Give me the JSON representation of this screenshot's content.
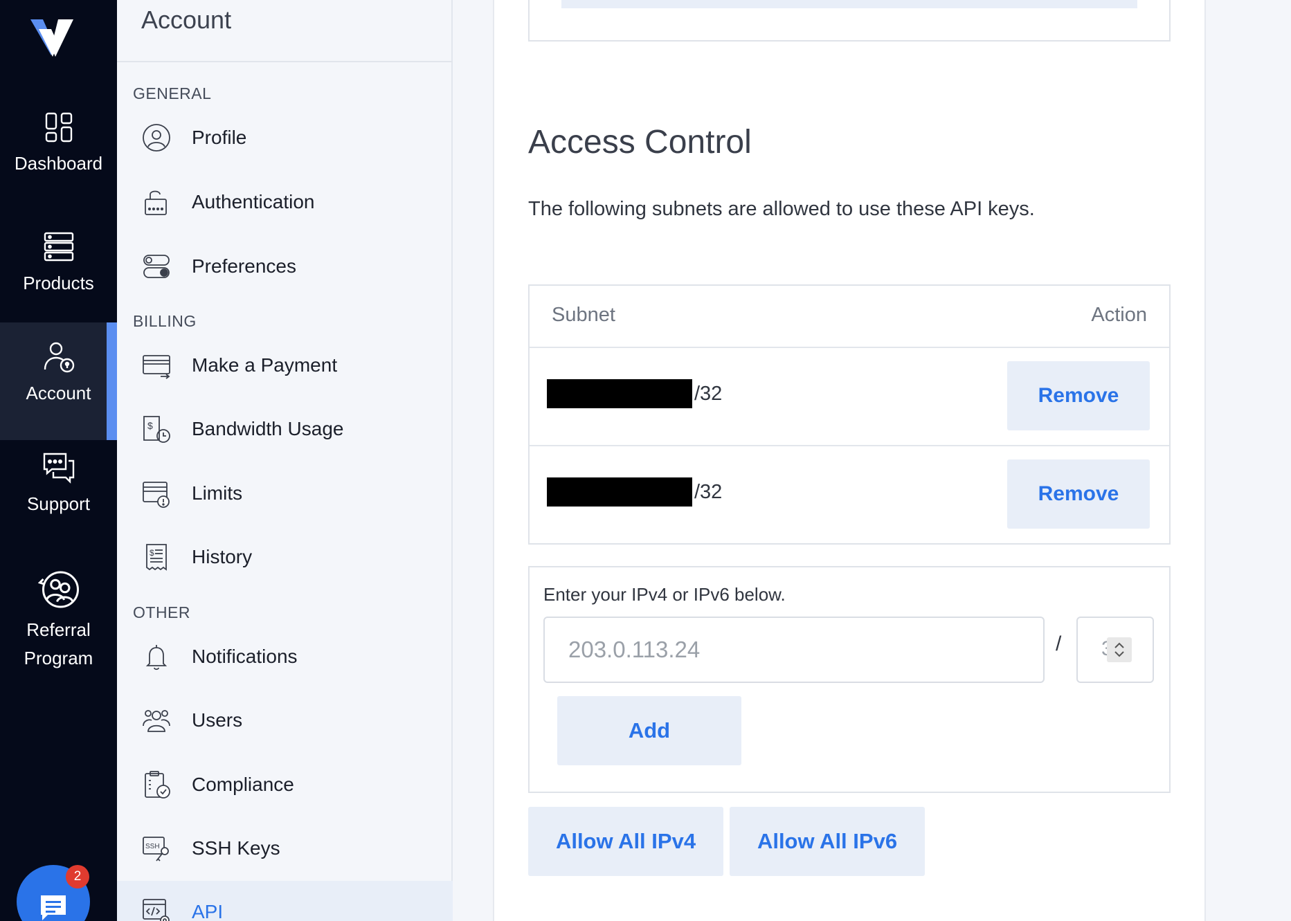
{
  "rail": {
    "items": [
      {
        "label": "Dashboard",
        "icon": "dashboard-icon"
      },
      {
        "label": "Products",
        "icon": "products-icon"
      },
      {
        "label": "Account",
        "icon": "account-icon",
        "active": true
      },
      {
        "label": "Support",
        "icon": "support-icon"
      },
      {
        "label": "Referral\nProgram",
        "icon": "referral-icon"
      }
    ],
    "chat_badge": "2"
  },
  "subnav": {
    "title": "Account",
    "sections": {
      "general": "GENERAL",
      "billing": "BILLING",
      "other": "OTHER"
    },
    "items": {
      "profile": "Profile",
      "authentication": "Authentication",
      "preferences": "Preferences",
      "payment": "Make a Payment",
      "bandwidth": "Bandwidth Usage",
      "limits": "Limits",
      "history": "History",
      "notifications": "Notifications",
      "users": "Users",
      "compliance": "Compliance",
      "ssh": "SSH Keys",
      "api": "API"
    },
    "active_item": "API"
  },
  "main": {
    "heading": "Access Control",
    "description": "The following subnets are allowed to use these API keys.",
    "table": {
      "col_subnet": "Subnet",
      "col_action": "Action",
      "rows": [
        {
          "cidr": "/32",
          "action": "Remove"
        },
        {
          "cidr": "/32",
          "action": "Remove"
        }
      ]
    },
    "add_form": {
      "label": "Enter your IPv4 or IPv6 below.",
      "ip_placeholder": "203.0.113.24",
      "slash": "/",
      "prefix_value": "3",
      "add_label": "Add"
    },
    "allow_ipv4": "Allow All IPv4",
    "allow_ipv6": "Allow All IPv6"
  },
  "colors": {
    "rail_bg": "#050a1a",
    "accent": "#2a73e8",
    "button_bg": "#e8eef8",
    "badge": "#e03b2f"
  }
}
